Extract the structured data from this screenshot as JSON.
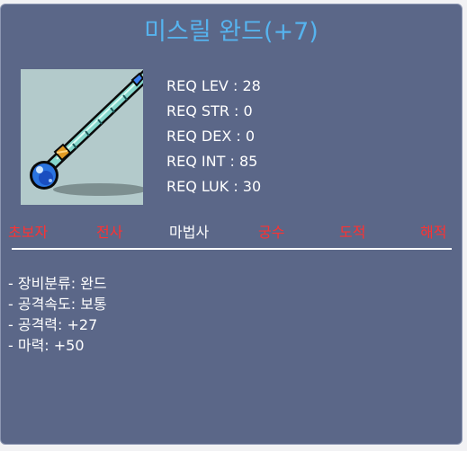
{
  "item": {
    "name": "미스릴 완드(+7)",
    "image_icon": "mithril-wand-icon",
    "requirements": [
      {
        "label": "REQ LEV",
        "value": "28"
      },
      {
        "label": "REQ STR",
        "value": "0"
      },
      {
        "label": "REQ DEX",
        "value": "0"
      },
      {
        "label": "REQ INT",
        "value": "85"
      },
      {
        "label": "REQ LUK",
        "value": "30"
      }
    ],
    "jobs": [
      {
        "label": "초보자",
        "available": false
      },
      {
        "label": "전사",
        "available": false
      },
      {
        "label": "마법사",
        "available": true
      },
      {
        "label": "궁수",
        "available": false
      },
      {
        "label": "도적",
        "available": false
      },
      {
        "label": "해적",
        "available": false
      }
    ],
    "details": [
      "- 장비분류: 완드",
      "- 공격속도: 보통",
      "- 공격력: +27",
      "- 마력: +50"
    ]
  },
  "colors": {
    "panel_bg": "#5b6788",
    "title": "#56b3ee",
    "unavailable_job": "#ff3131",
    "available_job": "#ffffff"
  }
}
